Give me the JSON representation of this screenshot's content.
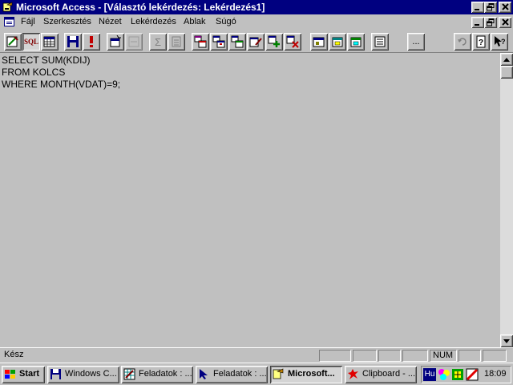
{
  "window": {
    "title": "Microsoft Access - [Választó lekérdezés: Lekérdezés1]"
  },
  "menu": {
    "items": [
      "Fájl",
      "Szerkesztés",
      "Nézet",
      "Lekérdezés",
      "Ablak",
      "Súgó"
    ]
  },
  "toolbar": {
    "sql_label": "SQL",
    "ellipsis_label": "...",
    "sigma_label": "Σ"
  },
  "editor": {
    "sql_text": "SELECT SUM(KDIJ)\nFROM KOLCS\nWHERE MONTH(VDAT)=9;"
  },
  "status": {
    "text": "Kész",
    "num": "NUM"
  },
  "taskbar": {
    "start_label": "Start",
    "tasks": [
      {
        "label": "Windows C..."
      },
      {
        "label": "Feladatok : ..."
      },
      {
        "label": "Feladatok : ..."
      },
      {
        "label": "Microsoft..."
      },
      {
        "label": "Clipboard - ..."
      }
    ],
    "tray": {
      "lang": "Hu",
      "clock": "18:09"
    }
  },
  "colors": {
    "titlebar": "#000080",
    "face": "#c0c0c0"
  }
}
